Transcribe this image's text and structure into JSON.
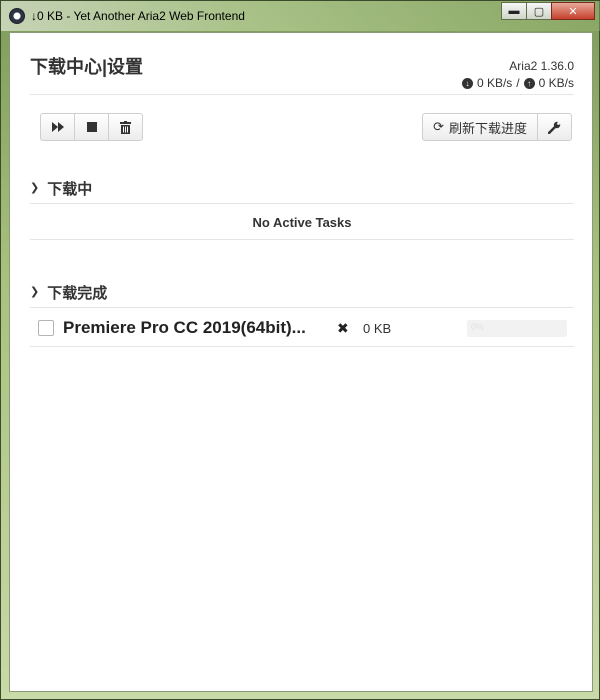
{
  "window": {
    "title": "↓0 KB - Yet Another Aria2 Web Frontend",
    "minimize": "▬",
    "maximize": "▢",
    "close": "✕"
  },
  "header": {
    "title": "下载中心|设置",
    "version": "Aria2 1.36.0",
    "download_speed": "0 KB/s",
    "separator": "/",
    "upload_speed": "0 KB/s"
  },
  "toolbar": {
    "start_icon": "fast-forward-icon",
    "stop_icon": "stop-icon",
    "delete_icon": "trash-icon",
    "refresh_label": "刷新下载进度",
    "settings_icon": "wrench-icon"
  },
  "sections": {
    "active": {
      "title": "下载中",
      "empty_text": "No Active Tasks"
    },
    "completed": {
      "title": "下载完成",
      "tasks": [
        {
          "name": "Premiere Pro CC 2019(64bit)...",
          "status_icon": "cross-icon",
          "size": "0 KB",
          "progress_percent": 0,
          "progress_text": "0%"
        }
      ]
    }
  },
  "colors": {
    "progress_fill": "#5cb85c",
    "text": "#333333"
  }
}
